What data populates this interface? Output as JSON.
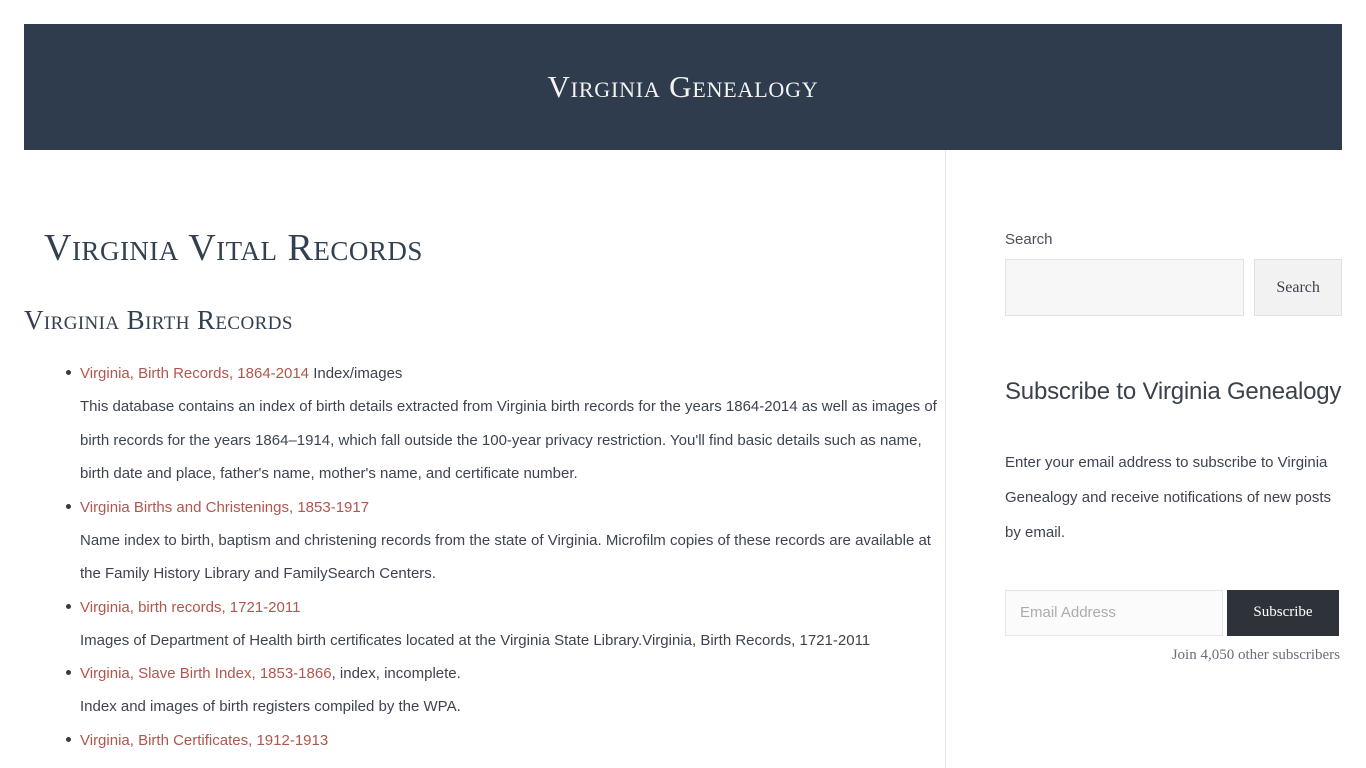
{
  "header": {
    "site_title": "Virginia Genealogy",
    "background_color": "#2f3c4e"
  },
  "main": {
    "page_title": "Virginia Vital Records",
    "section_title": "Virginia Birth Records",
    "link_color": "#b0564e",
    "records": [
      {
        "link": "Virginia, Birth Records, 1864-2014",
        "suffix": " Index/images",
        "description": "This database contains an index of birth details extracted from Virginia birth records for the years 1864-2014 as well as images of birth records for the years 1864–1914, which fall outside the 100-year privacy restriction. You'll find basic details such as name, birth date and place, father's name, mother's name, and certificate number."
      },
      {
        "link": "Virginia Births and Christenings, 1853-1917",
        "suffix": "",
        "description": "Name index to birth, baptism and christening records from the state of Virginia. Microfilm copies of these records are available at the Family History Library and FamilySearch Centers."
      },
      {
        "link": "Virginia, birth records, 1721-2011",
        "suffix": "",
        "description": "Images of Department of Health birth certificates located at the Virginia State Library.Virginia, Birth Records, 1721-2011"
      },
      {
        "link": "Virginia, Slave Birth Index, 1853-1866",
        "suffix": ", index, incomplete.",
        "description": "Index and images of birth registers compiled by the WPA."
      },
      {
        "link": "Virginia, Birth Certificates, 1912-1913",
        "suffix": "",
        "description": ""
      }
    ]
  },
  "sidebar": {
    "search": {
      "label": "Search",
      "input_value": "",
      "input_placeholder": "",
      "button_label": "Search"
    },
    "subscribe": {
      "title": "Subscribe to Virginia Genealogy",
      "description": "Enter your email address to subscribe to Virginia Genealogy and receive notifications of new posts by email.",
      "email_value": "",
      "email_placeholder": "Email Address",
      "button_label": "Subscribe",
      "button_color": "#2d3338",
      "subscriber_count": "Join 4,050 other subscribers"
    }
  }
}
